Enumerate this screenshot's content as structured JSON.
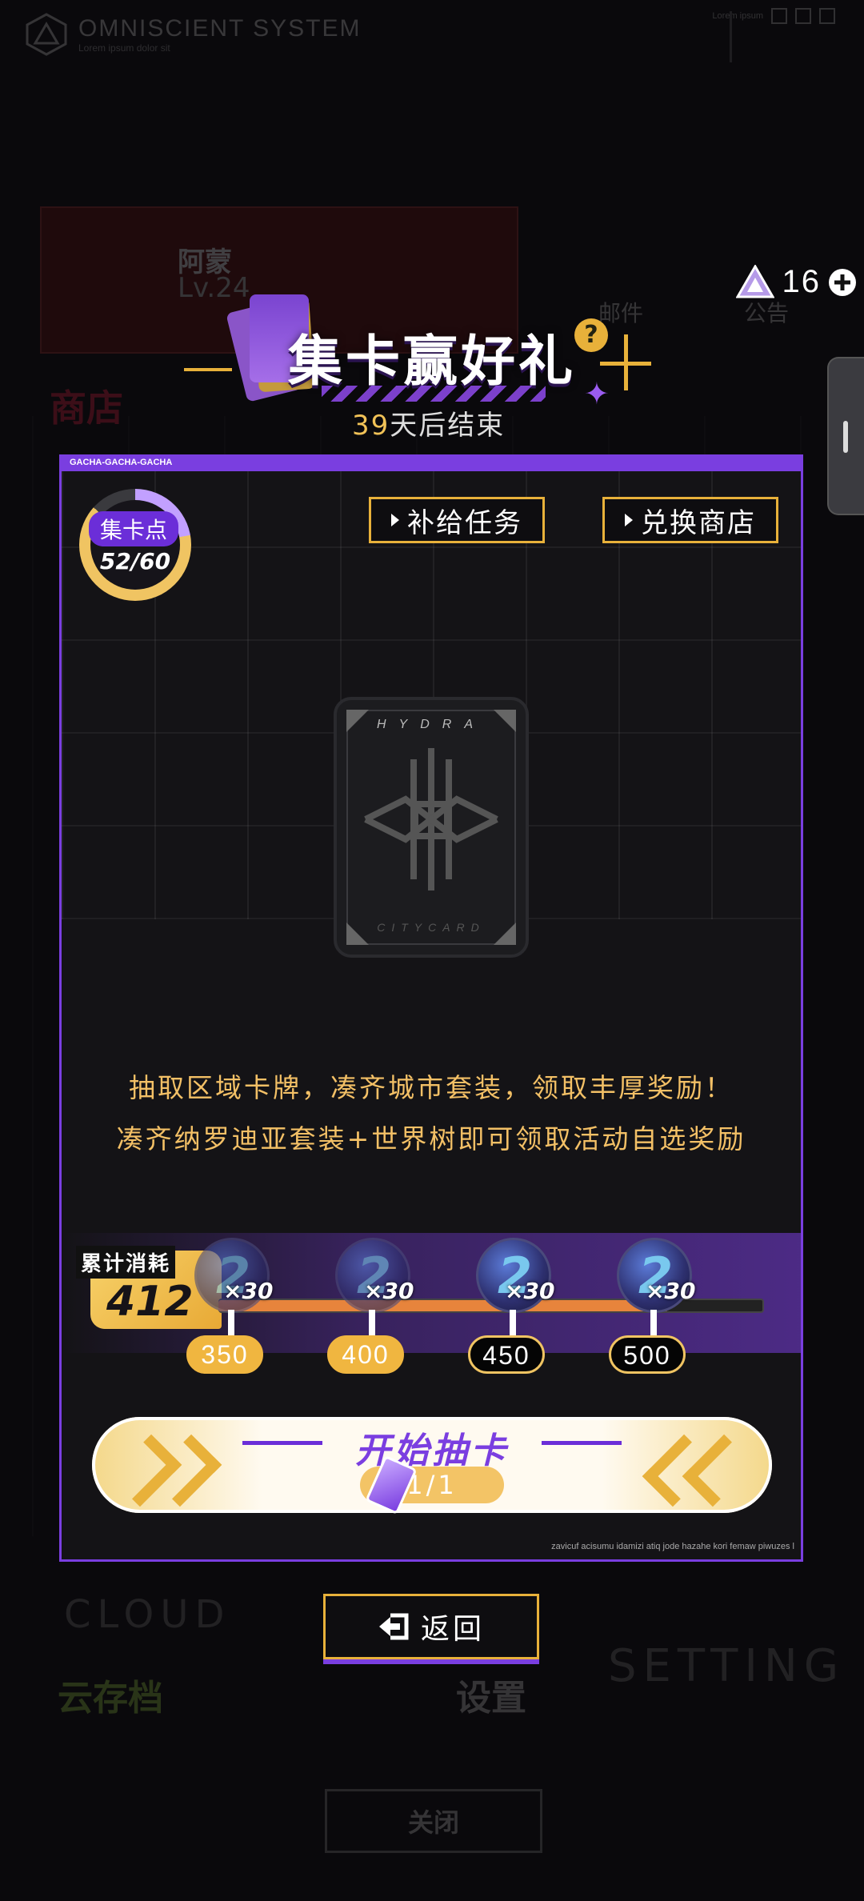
{
  "background": {
    "logo_title": "OMNISCIENT SYSTEM",
    "logo_subtitle": "Lorem ipsum dolor sit",
    "top_right_label": "Lorem ipsum",
    "player_name": "阿蒙",
    "player_level": "Lv.24",
    "shop": "商店",
    "mail": "邮件",
    "notice": "公告",
    "cloud_word": "CLOUD",
    "cloud_save": "云存档",
    "setting_word": "SETTING",
    "settings": "设置",
    "close": "关闭"
  },
  "currency": {
    "icon": "crystal-triangle-icon",
    "value": "16",
    "add_icon": "plus-circle-icon"
  },
  "event": {
    "title": "集卡赢好礼",
    "days_left": "39",
    "days_suffix": "天后结束",
    "help_icon": "question-icon"
  },
  "panel": {
    "header_tag": "GACHA-GACHA-GACHA",
    "points_label": "集卡点",
    "points_value": "52/60",
    "points_progress": 0.867,
    "supply_task_button": "补给任务",
    "exchange_shop_button": "兑换商店",
    "card_top_text": "HYDRA",
    "card_bottom_text": "CITYCARD",
    "description_line1": "抽取区域卡牌，凑齐城市套装，领取丰厚奖励！",
    "description_line2": "凑齐纳罗迪亚套装+世界树即可领取活动自选奖励",
    "cumulative_label": "累计消耗",
    "cumulative_value": "412",
    "milestones": [
      {
        "threshold": "350",
        "reward": "×30",
        "reached": true
      },
      {
        "threshold": "400",
        "reward": "×30",
        "reached": true
      },
      {
        "threshold": "450",
        "reward": "×30",
        "reached": false
      },
      {
        "threshold": "500",
        "reward": "×30",
        "reached": false
      }
    ],
    "progress_fraction": 0.824,
    "start_button": "开始抽卡",
    "start_count": "1/1",
    "footnote": "zavicuf acisumu idamizi atiq jode hazahe kori femaw piwuzes l"
  },
  "back_button": "返回",
  "colors": {
    "accent_purple": "#7a3ee0",
    "accent_gold": "#e8b13a",
    "text_gold": "#f3c066"
  }
}
